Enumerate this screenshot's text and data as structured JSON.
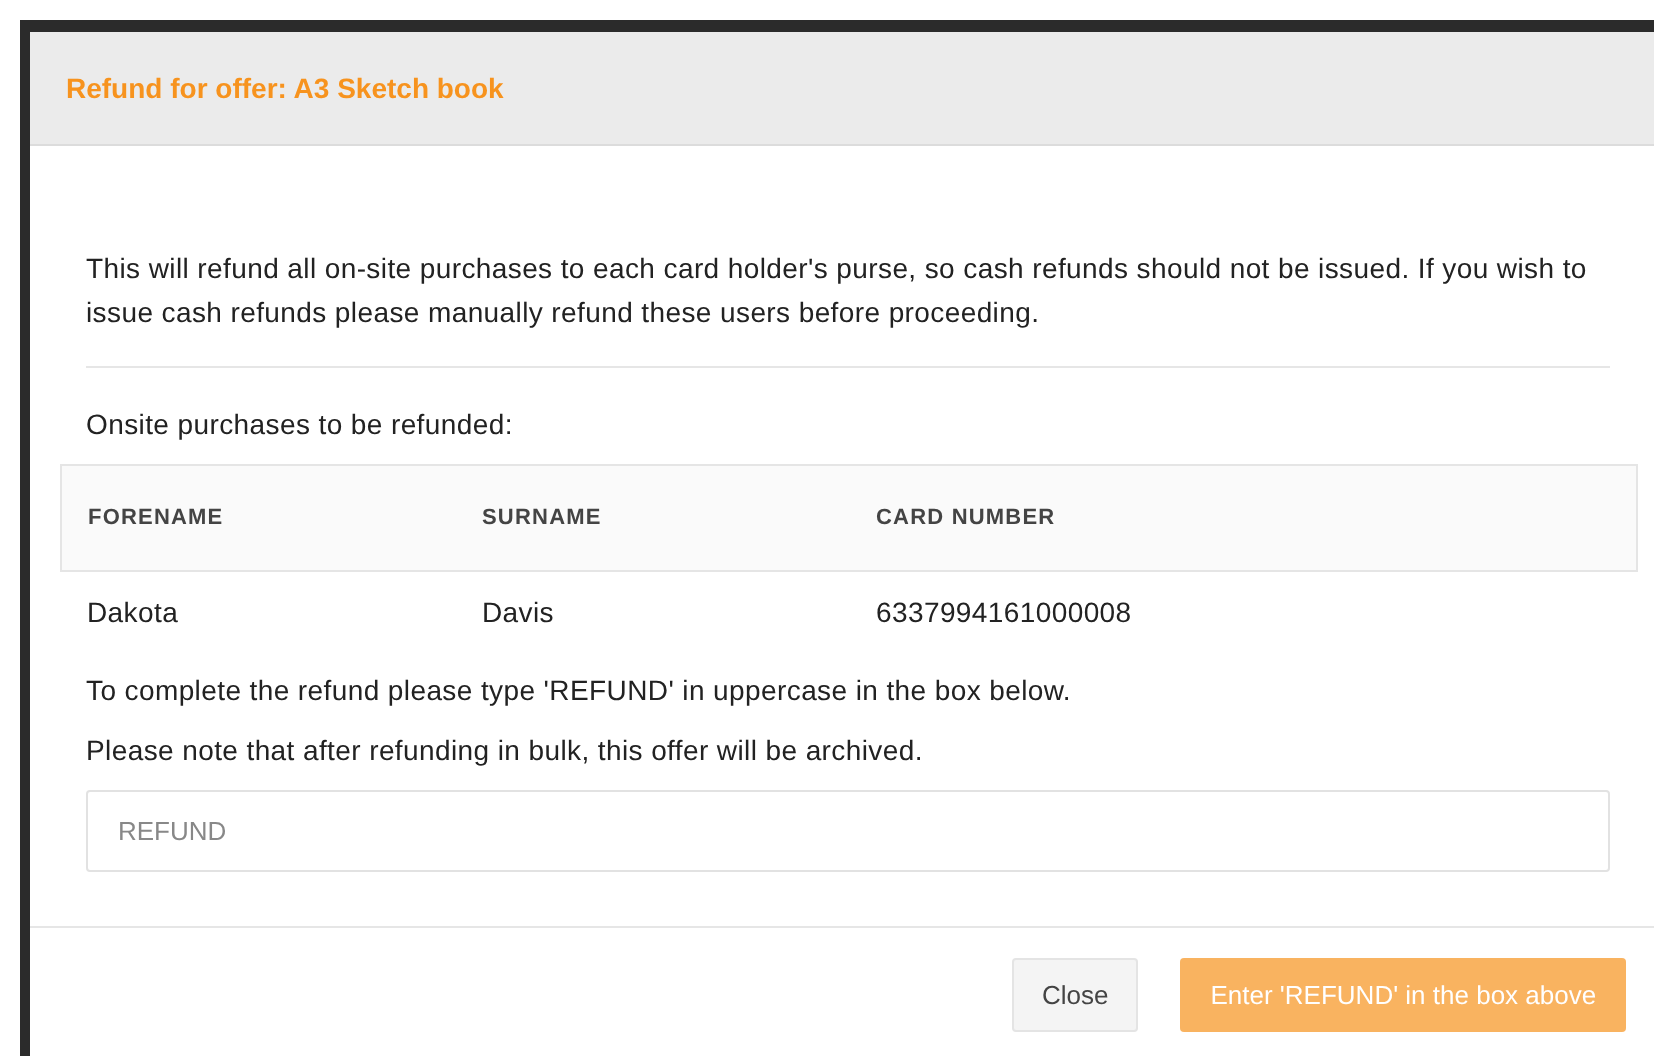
{
  "modal": {
    "title": "Refund for offer: A3 Sketch book",
    "intro": "This will refund all on-site purchases to each card holder's purse, so cash refunds should not be issued. If you wish to issue cash refunds please manually refund these users before proceeding.",
    "list_heading": "Onsite purchases to be refunded:",
    "table": {
      "columns": [
        "FORENAME",
        "SURNAME",
        "CARD NUMBER"
      ],
      "rows": [
        [
          "Dakota",
          "Davis",
          "6337994161000008"
        ]
      ]
    },
    "instruction": "To complete the refund please type 'REFUND' in uppercase in the box below.",
    "note": "Please note that after refunding in bulk, this offer will be archived.",
    "confirm_field": {
      "placeholder": "REFUND"
    },
    "buttons": [
      {
        "label": "Close",
        "kind": "secondary",
        "disabled": false
      },
      {
        "label": "Enter 'REFUND' in the box above",
        "kind": "primary",
        "disabled": true
      }
    ]
  }
}
